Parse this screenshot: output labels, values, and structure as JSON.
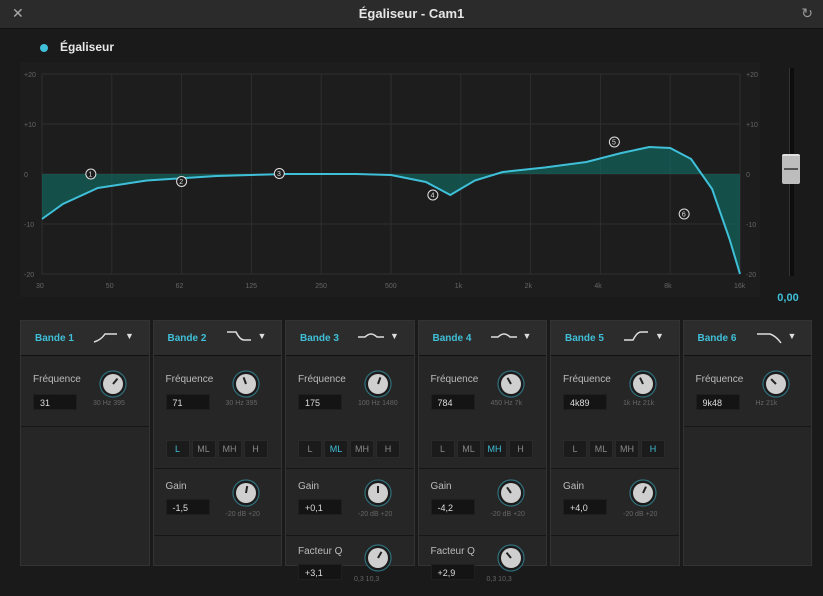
{
  "window": {
    "title": "Égaliseur - Cam1",
    "close_icon": "✕",
    "reset_icon": "↻"
  },
  "enable": {
    "label": "Égaliseur",
    "on": true
  },
  "graph": {
    "y_left": [
      "+20",
      "+10",
      "0",
      "-10",
      "-20"
    ],
    "y_right": [
      "+20",
      "+10",
      "0",
      "-10",
      "-20"
    ],
    "x_ticks": [
      "30",
      "50",
      "62",
      "125",
      "250",
      "500",
      "1k",
      "2k",
      "4k",
      "8k",
      "16k"
    ],
    "curve_color": "#3fc0d8",
    "fill_color": "#0f6a63",
    "markers": [
      {
        "id": "1",
        "freq_label": "31",
        "gain": 0
      },
      {
        "id": "2",
        "freq_label": "71",
        "gain": -1.5
      },
      {
        "id": "3",
        "freq_label": "175",
        "gain": 0.1
      },
      {
        "id": "4",
        "freq_label": "784",
        "gain": -4.2
      },
      {
        "id": "5",
        "freq_label": "4k89",
        "gain": 4.0
      },
      {
        "id": "6",
        "freq_label": "9k48",
        "gain": -8
      }
    ]
  },
  "master": {
    "value": "0,00"
  },
  "segments": [
    "L",
    "ML",
    "MH",
    "H"
  ],
  "bands": [
    {
      "name": "Bande 1",
      "shape": "highpass",
      "freq_label": "Fréquence",
      "freq_value": "31",
      "freq_range": "30 Hz  395",
      "knob_angle": 40
    },
    {
      "name": "Bande 2",
      "shape": "lowshelf",
      "freq_label": "Fréquence",
      "freq_value": "71",
      "freq_range": "30 Hz  395",
      "knob_angle": -20,
      "segment_selected": "L",
      "gain_label": "Gain",
      "gain_value": "-1,5",
      "gain_range": "-20 dB  +20",
      "gain_angle": 10
    },
    {
      "name": "Bande 3",
      "shape": "bell",
      "freq_label": "Fréquence",
      "freq_value": "175",
      "freq_range": "100 Hz  1480",
      "knob_angle": 20,
      "segment_selected": "ML",
      "gain_label": "Gain",
      "gain_value": "+0,1",
      "gain_range": "-20 dB  +20",
      "gain_angle": 0,
      "q_label": "Facteur Q",
      "q_value": "+3,1",
      "q_range": "0,3  10,3",
      "q_angle": 30
    },
    {
      "name": "Bande 4",
      "shape": "bell",
      "freq_label": "Fréquence",
      "freq_value": "784",
      "freq_range": "450 Hz  7k",
      "knob_angle": -30,
      "segment_selected": "MH",
      "gain_label": "Gain",
      "gain_value": "-4,2",
      "gain_range": "-20 dB  +20",
      "gain_angle": -35,
      "q_label": "Facteur Q",
      "q_value": "+2,9",
      "q_range": "0,3  10,3",
      "q_angle": -40
    },
    {
      "name": "Bande 5",
      "shape": "highshelf",
      "freq_label": "Fréquence",
      "freq_value": "4k89",
      "freq_range": "1k Hz  21k",
      "knob_angle": -25,
      "segment_selected": "H",
      "gain_label": "Gain",
      "gain_value": "+4,0",
      "gain_range": "-20 dB  +20",
      "gain_angle": 25
    },
    {
      "name": "Bande 6",
      "shape": "lowpass",
      "freq_label": "Fréquence",
      "freq_value": "9k48",
      "freq_range": "Hz 21k",
      "knob_angle": -45
    }
  ]
}
